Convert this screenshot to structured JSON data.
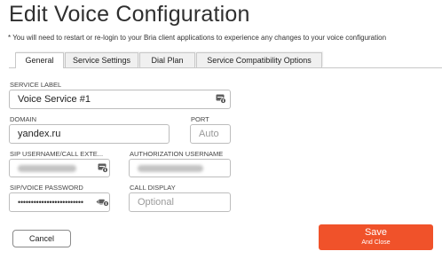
{
  "page": {
    "title": "Edit Voice Configuration",
    "note": "* You will need to restart or re-login to your Bria client applications to experience any changes to your voice configuration"
  },
  "tabs": [
    {
      "label": "General",
      "active": true
    },
    {
      "label": "Service Settings",
      "active": false
    },
    {
      "label": "Dial Plan",
      "active": false
    },
    {
      "label": "Service Compatibility Options",
      "active": false
    }
  ],
  "form": {
    "service_label": {
      "label": "SERVICE LABEL",
      "value": "Voice Service #1"
    },
    "domain": {
      "label": "DOMAIN",
      "value": "yandex.ru"
    },
    "port": {
      "label": "PORT",
      "placeholder": "Auto"
    },
    "sip_username": {
      "label": "SIP USERNAME/CALL EXTE...",
      "value_obscured": true
    },
    "auth_username": {
      "label": "AUTHORIZATION USERNAME",
      "value_obscured": true
    },
    "sip_password": {
      "label": "SIP/VOICE PASSWORD",
      "value": "•••••••••••••••••••••••••"
    },
    "call_display": {
      "label": "CALL DISPLAY",
      "placeholder": "Optional"
    }
  },
  "buttons": {
    "cancel": "Cancel",
    "save": "Save",
    "save_sub": "And Close"
  },
  "colors": {
    "accent": "#f0522a",
    "border": "#bdbdbd"
  },
  "icons": {
    "field_action": "password-key-icon"
  }
}
